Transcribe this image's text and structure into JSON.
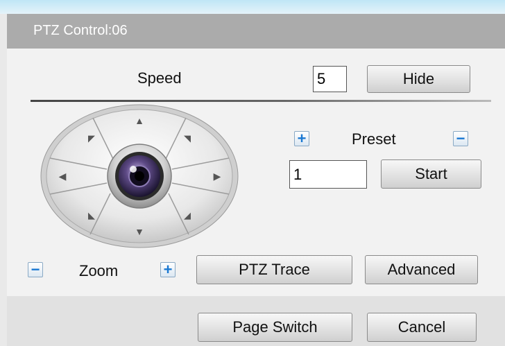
{
  "dialog": {
    "title": "PTZ Control:06"
  },
  "speed": {
    "label": "Speed",
    "value": "5"
  },
  "buttons": {
    "hide": "Hide",
    "start": "Start",
    "ptz_trace": "PTZ Trace",
    "advanced": "Advanced",
    "page_switch": "Page Switch",
    "cancel": "Cancel"
  },
  "preset": {
    "label": "Preset",
    "value": "1",
    "plus": "+",
    "minus": "−"
  },
  "zoom": {
    "label": "Zoom",
    "plus": "+",
    "minus": "−"
  },
  "icons": {
    "arrow_up": "▲",
    "arrow_down": "▼",
    "arrow_left": "◀",
    "arrow_right": "▶",
    "arrow_up_left": "◤",
    "arrow_up_right": "◥",
    "arrow_down_left": "◣",
    "arrow_down_right": "◢"
  },
  "colors": {
    "title_bar": "#ababab",
    "accent_blue": "#1a78d2",
    "panel": "#f2f2f2"
  }
}
